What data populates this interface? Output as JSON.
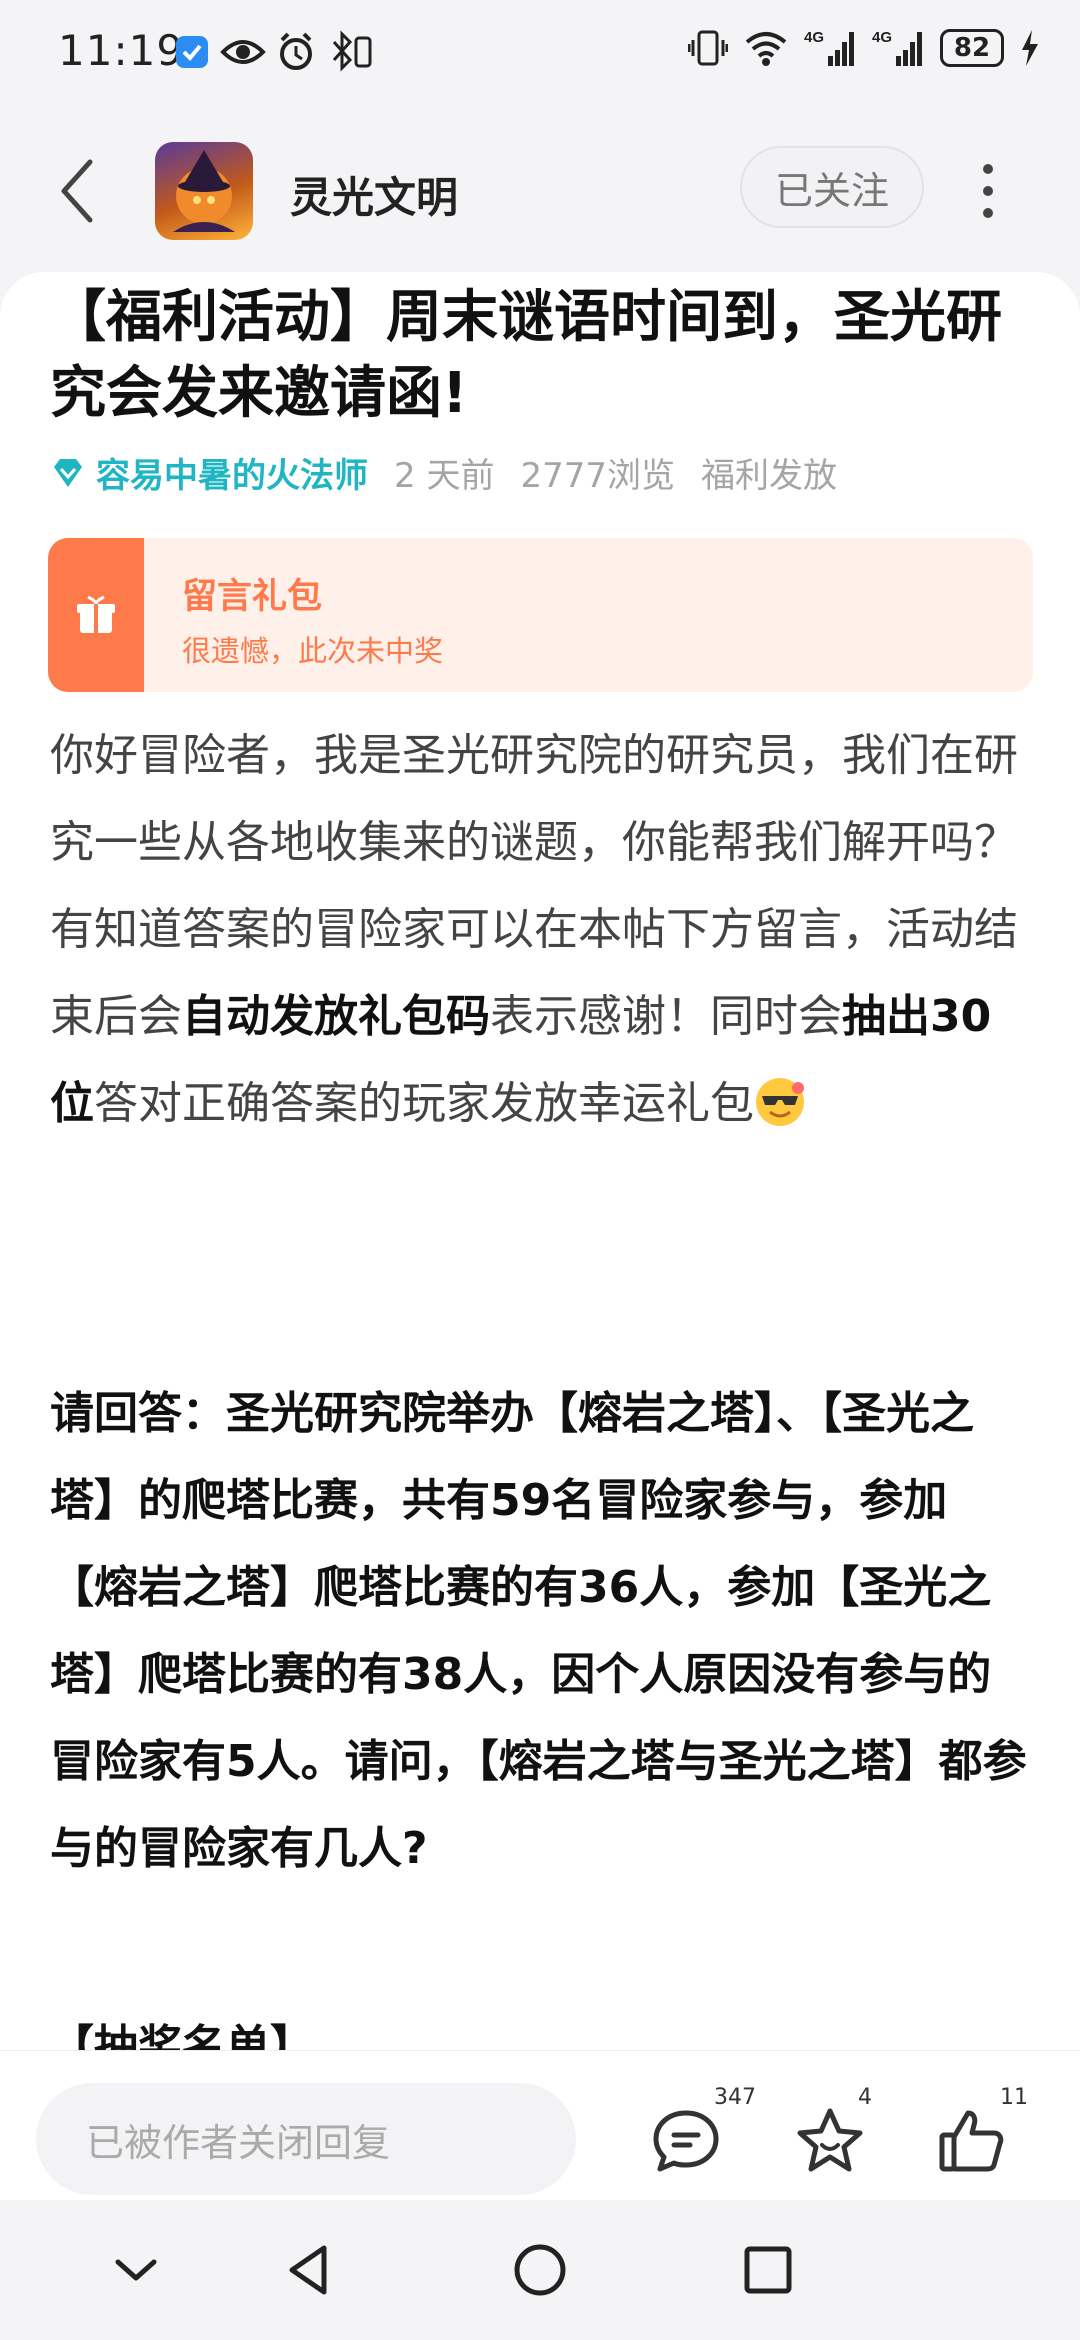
{
  "status_bar": {
    "time": "11:19",
    "battery": "82",
    "icons": [
      "app-notification-icon",
      "eye-icon",
      "alarm-icon",
      "bluetooth-icon",
      "vibrate-icon",
      "wifi-icon",
      "signal-4g-icon",
      "signal-4g-icon",
      "charging-icon"
    ]
  },
  "header": {
    "app_name": "灵光文明",
    "follow_label": "已关注"
  },
  "post": {
    "title": "【福利活动】周末谜语时间到，圣光研究会发来邀请函!",
    "author": "容易中暑的火法师",
    "time_ago": "2 天前",
    "views": "2777浏览",
    "category": "福利发放",
    "gift": {
      "title": "留言礼包",
      "subtitle": "很遗憾，此次未中奖"
    },
    "body": {
      "p1": "你好冒险者，我是圣光研究院的研究员，我们在研究一些从各地收集来的谜题，你能帮我们解开吗？有知道答案的冒险家可以在本帖下方留言，活动结束后会",
      "p1_bold": "自动发放礼包码",
      "p2": "表示感谢！同时会",
      "p2_bold": "抽出30位",
      "p3": "答对正确答案的玩家发放幸运礼包"
    },
    "question": "请回答：圣光研究院举办【熔岩之塔】、【圣光之塔】的爬塔比赛，共有59名冒险家参与，参加【熔岩之塔】爬塔比赛的有36人，参加【圣光之塔】爬塔比赛的有38人，因个人原因没有参与的冒险家有5人。请问，【熔岩之塔与圣光之塔】都参与的冒险家有几人?",
    "draw_list_title": "【抽奖名单】"
  },
  "bottom_bar": {
    "reply_placeholder": "已被作者关闭回复",
    "comment_count": "347",
    "favorite_count": "4",
    "like_count": "11"
  },
  "colors": {
    "accent": "#1fb5c3",
    "gift_orange": "#ff7a4a",
    "gift_bg": "#fff0ea"
  }
}
